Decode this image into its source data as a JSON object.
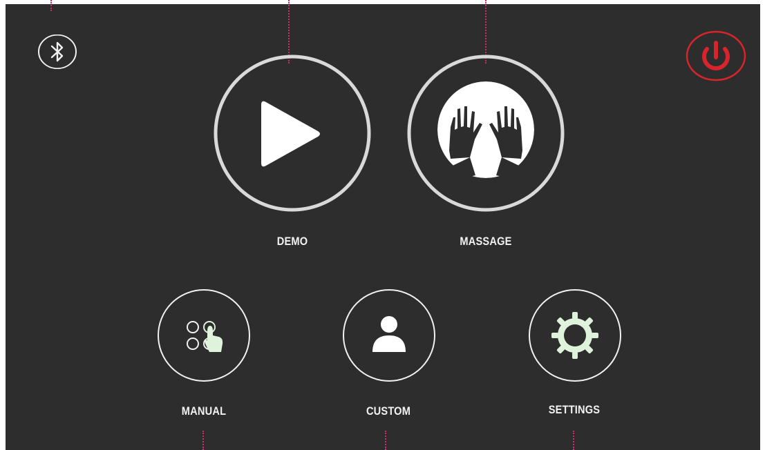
{
  "menu": {
    "demo_label": "DEMO",
    "massage_label": "MASSAGE",
    "manual_label": "MANUAL",
    "custom_label": "CUSTOM",
    "settings_label": "SETTINGS"
  },
  "icons": {
    "bluetooth": "bluetooth-icon",
    "power": "power-icon",
    "demo": "play-icon",
    "massage": "hands-icon",
    "manual": "touch-select-icon",
    "custom": "user-icon",
    "settings": "gear-icon"
  },
  "colors": {
    "background": "#2e2d2d",
    "foreground": "#f2f2f2",
    "power": "#d8252b",
    "annotation": "#d1286e",
    "icon_accent": "#dff2dc"
  }
}
